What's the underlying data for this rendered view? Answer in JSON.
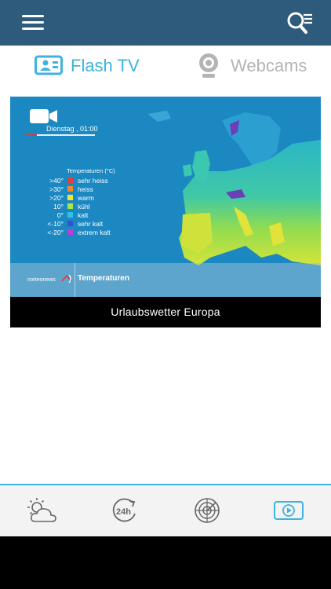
{
  "app": {
    "accent_color": "#3eb3dc",
    "header_color": "#2e5a7c",
    "header": {
      "menu_icon": "menu-icon",
      "search_icon": "search-list-icon"
    }
  },
  "tabs": [
    {
      "label": "Flash TV",
      "icon": "tv-presenter-icon",
      "active": true
    },
    {
      "label": "Webcams",
      "icon": "webcam-icon",
      "active": false
    }
  ],
  "video": {
    "caption": "Urlaubswetter Europa",
    "overlay": {
      "date": "Dienstag , 01:00",
      "legend_title": "Temperaturen (°C)",
      "legend": [
        {
          "value": ">40°",
          "label": "sehr heiss",
          "color": "#e23f3f"
        },
        {
          "value": ">30°",
          "label": "heiss",
          "color": "#f08a28"
        },
        {
          "value": ">20°",
          "label": "warm",
          "color": "#f2e23a"
        },
        {
          "value": "10°",
          "label": "kühl",
          "color": "#a9e64a"
        },
        {
          "value": "0°",
          "label": "kalt",
          "color": "#30c0e8"
        },
        {
          "value": "<-10°",
          "label": "sehr kalt",
          "color": "#3a4fd8"
        },
        {
          "value": "<-20°",
          "label": "extrem kalt",
          "color": "#c03cd8"
        }
      ],
      "brand": "meteonews",
      "section": "Temperaturen"
    }
  },
  "bottom_nav": [
    {
      "icon": "weather-sun-cloud-icon",
      "active": false
    },
    {
      "icon": "forecast-24h-icon",
      "active": false
    },
    {
      "icon": "radar-icon",
      "active": false
    },
    {
      "icon": "video-play-icon",
      "active": true
    }
  ]
}
